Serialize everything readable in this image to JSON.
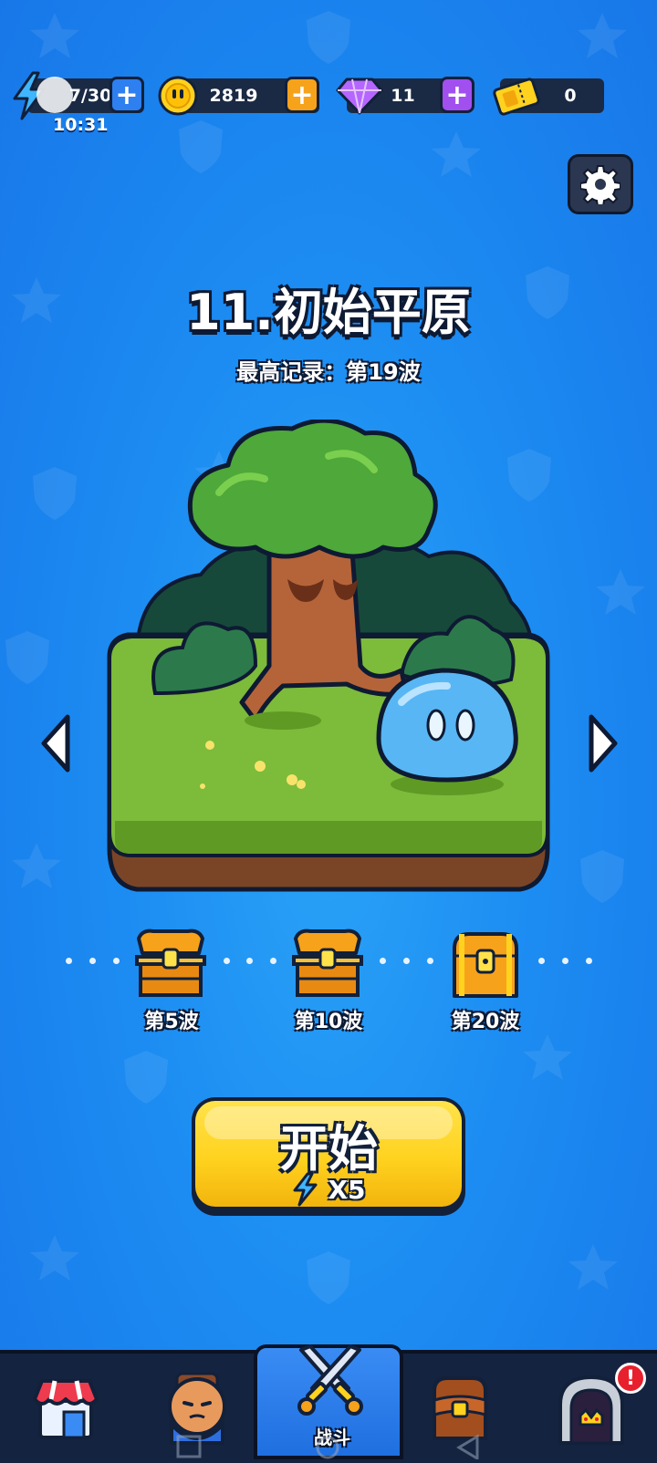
{
  "resources": {
    "energy": {
      "value": "7/30",
      "timer": "10:31",
      "icon": "lightning-icon"
    },
    "coins": {
      "value": "2819",
      "icon": "coin-icon"
    },
    "gems": {
      "value": "11",
      "icon": "gem-icon"
    },
    "tickets": {
      "value": "0",
      "icon": "ticket-icon"
    }
  },
  "level": {
    "title": "11.初始平原",
    "record": "最高记录：第19波"
  },
  "rewards": [
    {
      "label": "第5波",
      "icon": "chest-open-icon"
    },
    {
      "label": "第10波",
      "icon": "chest-open-icon"
    },
    {
      "label": "第20波",
      "icon": "chest-closed-icon"
    }
  ],
  "start_button": {
    "label": "开始",
    "cost": "X5"
  },
  "nav": {
    "items": [
      {
        "icon": "shop-icon"
      },
      {
        "icon": "hero-icon"
      },
      {
        "icon": "battle-swords-icon",
        "label": "战斗"
      },
      {
        "icon": "backpack-icon"
      },
      {
        "icon": "dungeon-gate-icon",
        "badge": "!"
      }
    ]
  },
  "colors": {
    "background": "#1c8cf2",
    "plus_blue": "#2e7ff0",
    "plus_orange": "#f7a21b",
    "plus_purple": "#a24ff0",
    "start_yellow": "#ffd21f",
    "badge_red": "#e8202e"
  }
}
